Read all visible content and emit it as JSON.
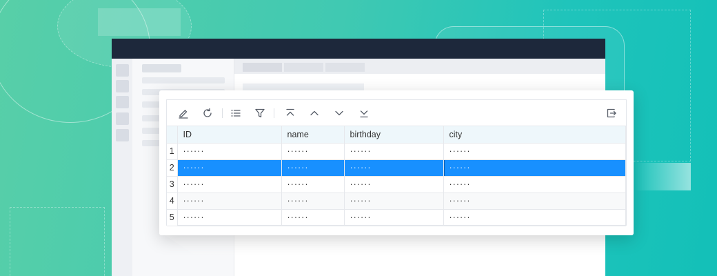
{
  "toolbar": {
    "left_icons": [
      "edit-icon",
      "refresh-icon",
      "list-icon",
      "filter-icon",
      "move-top-icon",
      "move-up-icon",
      "move-down-icon",
      "move-bottom-icon"
    ],
    "right_icons": [
      "export-icon"
    ]
  },
  "grid": {
    "columns": [
      "ID",
      "name",
      "birthday",
      "city"
    ],
    "rows": [
      {
        "num": "1",
        "cells": [
          "······",
          "······",
          "······",
          "······"
        ]
      },
      {
        "num": "2",
        "cells": [
          "······",
          "······",
          "······",
          "······"
        ]
      },
      {
        "num": "3",
        "cells": [
          "······",
          "······",
          "······",
          "······"
        ]
      },
      {
        "num": "4",
        "cells": [
          "······",
          "······",
          "······",
          "······"
        ]
      },
      {
        "num": "5",
        "cells": [
          "······",
          "······",
          "······",
          "······"
        ]
      }
    ],
    "selected_row": 2
  },
  "colors": {
    "selection": "#1890ff",
    "header_bg": "#eef7fb",
    "titlebar": "#1d283b"
  }
}
